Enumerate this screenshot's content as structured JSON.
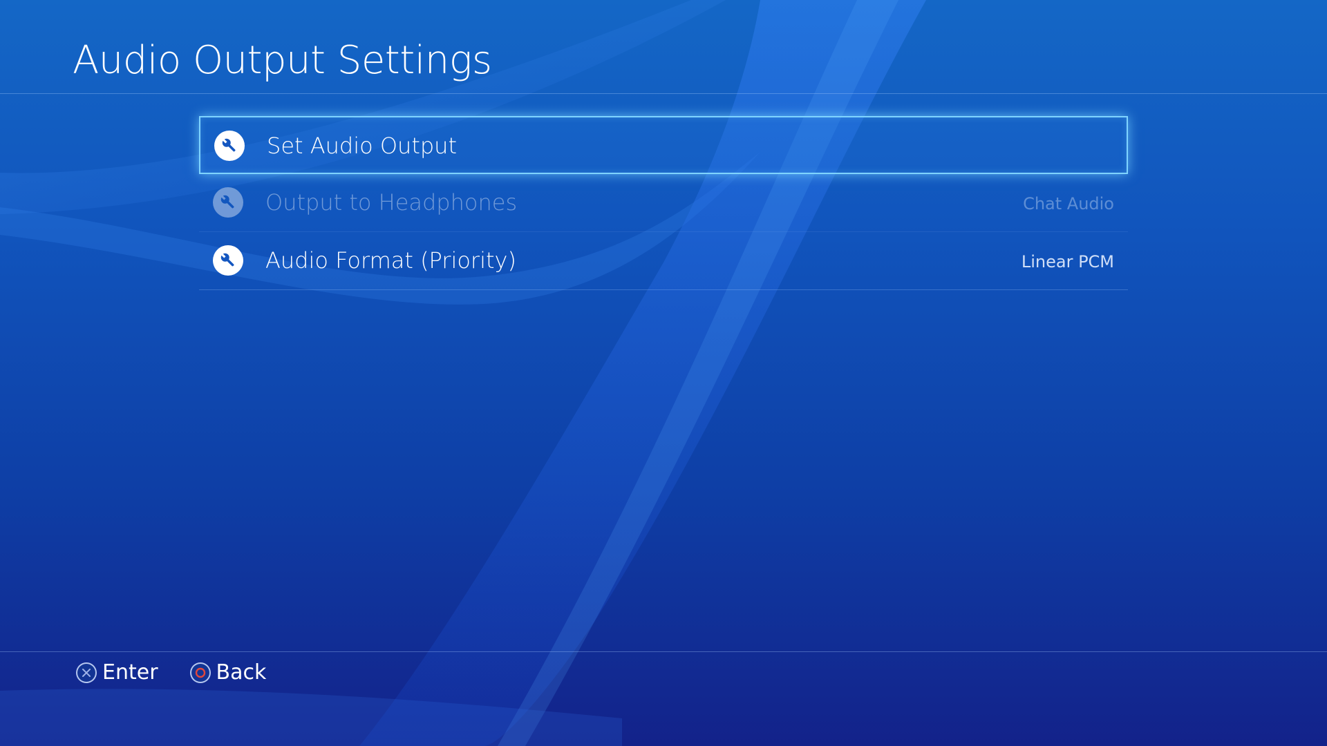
{
  "page": {
    "title": "Audio Output Settings"
  },
  "menu": {
    "items": [
      {
        "label": "Set Audio Output",
        "value": "",
        "icon": "wrench-icon",
        "state": "selected"
      },
      {
        "label": "Output to Headphones",
        "value": "Chat Audio",
        "icon": "wrench-icon",
        "state": "disabled"
      },
      {
        "label": "Audio Format (Priority)",
        "value": "Linear PCM",
        "icon": "wrench-icon",
        "state": "enabled"
      }
    ]
  },
  "footer": {
    "enter": {
      "label": "Enter",
      "icon": "cross-button-icon"
    },
    "back": {
      "label": "Back",
      "icon": "circle-button-icon"
    }
  },
  "colors": {
    "background_top": "#1467c6",
    "background_bottom": "#13228a",
    "selection_border": "#7fd4ff",
    "circle_button": "#e0483c",
    "cross_button": "#9fb3e8"
  }
}
